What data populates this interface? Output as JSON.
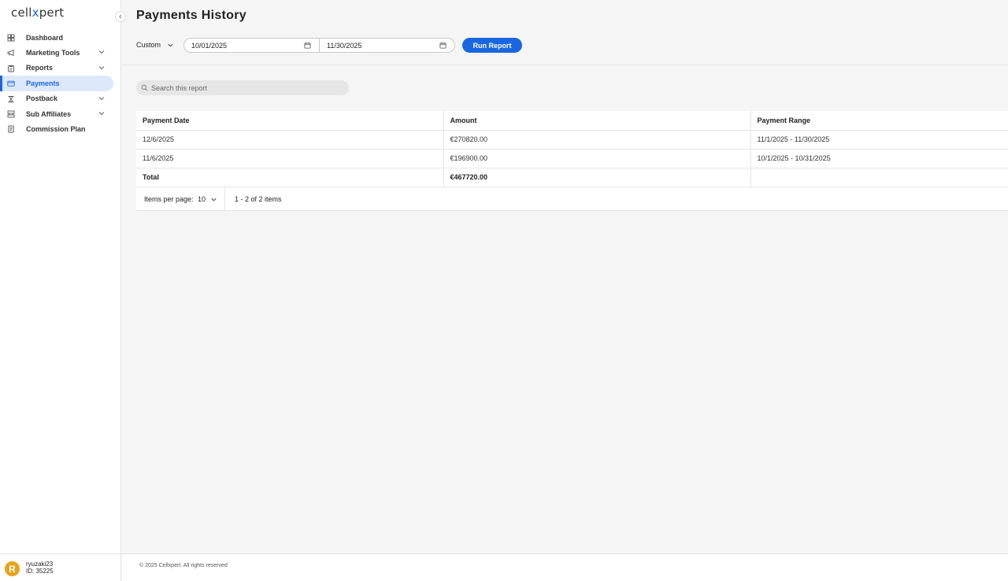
{
  "logo": {
    "pre": "cell",
    "x": "x",
    "post": "pert"
  },
  "sidebar": {
    "items": [
      {
        "label": "Dashboard",
        "icon": "dashboard-icon",
        "has_children": false,
        "active": false
      },
      {
        "label": "Marketing Tools",
        "icon": "megaphone-icon",
        "has_children": true,
        "active": false
      },
      {
        "label": "Reports",
        "icon": "report-icon",
        "has_children": true,
        "active": false
      },
      {
        "label": "Payments",
        "icon": "wallet-icon",
        "has_children": false,
        "active": true
      },
      {
        "label": "Postback",
        "icon": "postback-icon",
        "has_children": true,
        "active": false
      },
      {
        "label": "Sub Affiliates",
        "icon": "affiliates-icon",
        "has_children": true,
        "active": false
      },
      {
        "label": "Commission Plan",
        "icon": "document-icon",
        "has_children": false,
        "active": false
      }
    ]
  },
  "user": {
    "initial": "R",
    "name": "ryuzaki23",
    "id": "ID: 35225"
  },
  "page": {
    "title": "Payments History"
  },
  "filters": {
    "range": "Custom",
    "from": "10/01/2025",
    "to": "11/30/2025",
    "run_label": "Run Report"
  },
  "search": {
    "placeholder": "Search this report"
  },
  "table": {
    "headers": [
      "Payment Date",
      "Amount",
      "Payment Range"
    ],
    "rows": [
      [
        "12/6/2025",
        "€270820.00",
        "11/1/2025 - 11/30/2025"
      ],
      [
        "11/6/2025",
        "€196900.00",
        "10/1/2025 - 10/31/2025"
      ]
    ],
    "total": {
      "label": "Total",
      "amount": "€467720.00",
      "range": ""
    }
  },
  "pager": {
    "label": "Items per page:",
    "per_page": "10",
    "count": "1 - 2 of 2 items"
  },
  "footer": {
    "copyright": "© 2025 Cellxpert. All rights reserved"
  },
  "colors": {
    "accent": "#1a66e0",
    "active_bg": "#dde8fb",
    "avatar": "#e8a21a"
  }
}
